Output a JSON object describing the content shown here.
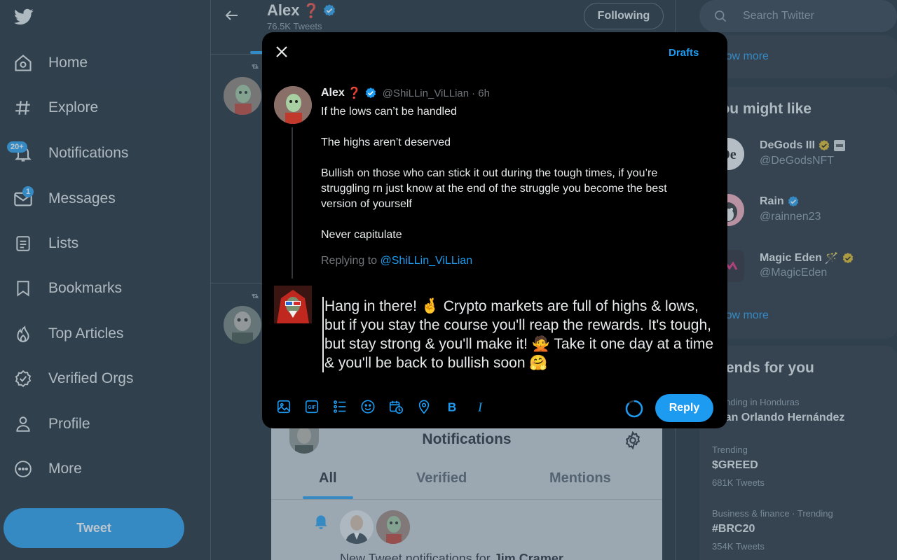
{
  "nav": {
    "items": [
      {
        "label": "Home",
        "icon": "home-icon"
      },
      {
        "label": "Explore",
        "icon": "hashtag-icon"
      },
      {
        "label": "Notifications",
        "icon": "bell-icon",
        "badge": "20+"
      },
      {
        "label": "Messages",
        "icon": "envelope-icon",
        "badge": "1"
      },
      {
        "label": "Lists",
        "icon": "list-icon"
      },
      {
        "label": "Bookmarks",
        "icon": "bookmark-icon"
      },
      {
        "label": "Top Articles",
        "icon": "flame-icon"
      },
      {
        "label": "Verified Orgs",
        "icon": "verified-badge-icon"
      },
      {
        "label": "Profile",
        "icon": "person-icon"
      },
      {
        "label": "More",
        "icon": "more-circle-icon"
      }
    ],
    "tweet_label": "Tweet"
  },
  "profile": {
    "name": "Alex",
    "name_emoji": "❓",
    "tweet_count": "76.5K Tweets",
    "following_label": "Following"
  },
  "notifications_panel": {
    "title": "Notifications",
    "tabs": [
      "All",
      "Verified",
      "Mentions"
    ],
    "active_tab": "All",
    "item_text_prefix": "New Tweet notifications for ",
    "item_text_name": "Jim Cramer"
  },
  "right": {
    "search_placeholder": "Search Twitter",
    "show_more": "Show more",
    "who_to_follow_title": "You might like",
    "suggestions": [
      {
        "name": "DeGods III",
        "handle": "@DeGodsNFT"
      },
      {
        "name": "Rain",
        "handle": "@rainnen23"
      },
      {
        "name": "Magic Eden",
        "name_emoji": "🪄",
        "handle": "@MagicEden"
      }
    ],
    "trends_title": "Trends for you",
    "trends": [
      {
        "meta": "Trending in Honduras",
        "name": "Juan Orlando Hernández",
        "count": ""
      },
      {
        "meta": "Trending",
        "name": "$GREED",
        "count": "681K Tweets"
      },
      {
        "meta": "Business & finance · Trending",
        "name": "#BRC20",
        "count": "354K Tweets"
      }
    ]
  },
  "modal": {
    "drafts_label": "Drafts",
    "original": {
      "name": "Alex",
      "name_emoji": "❓",
      "handle": "@ShiLLin_ViLLian",
      "time": "· 6h",
      "paragraphs": [
        "If the lows can’t be handled",
        "The highs aren’t deserved",
        "Bullish on those who can stick it out during the tough times, if you’re struggling rn just know at the end of the struggle you become the best version of yourself",
        "Never capitulate"
      ],
      "replying_prefix": "Replying to ",
      "replying_handle": "@ShiLLin_ViLLian"
    },
    "compose_text": "Hang in there!  🤞  Crypto markets are full of highs & lows, but if you stay the course you'll reap the rewards. It's tough, but stay strong & you'll make it!  🙅  Take it one day at a time & you'll be back to bullish soon  🤗",
    "toolbar_icons": [
      "image-icon",
      "gif-icon",
      "poll-icon",
      "emoji-icon",
      "schedule-icon",
      "location-icon",
      "bold-icon",
      "italic-icon"
    ],
    "reply_label": "Reply"
  },
  "colors": {
    "accent": "#1d9bf0",
    "background": "#15202b",
    "modal_background": "#000000",
    "verified_gold": "#e2b719"
  }
}
